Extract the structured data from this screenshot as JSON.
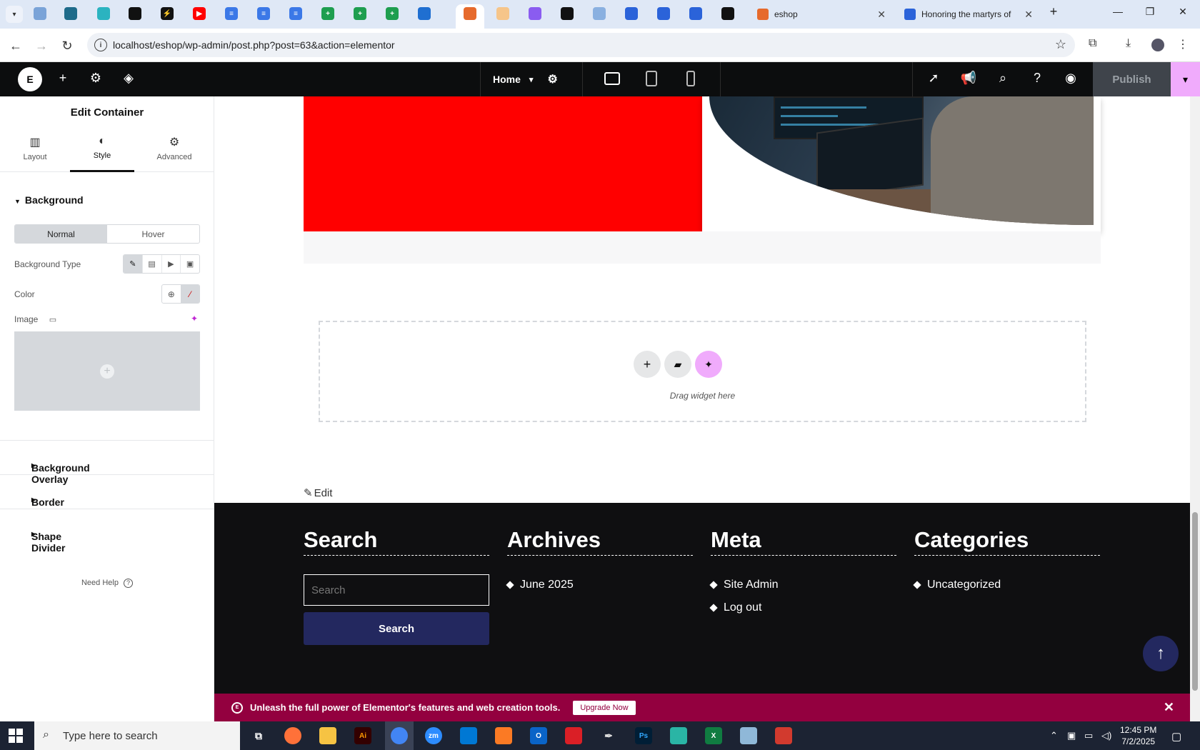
{
  "browser": {
    "tabs": [
      {
        "title": "eshop",
        "favicon_color": "#e66a2c"
      },
      {
        "title": "Honoring the martyrs of",
        "favicon_color": "#2b63d9"
      }
    ],
    "address": "localhost/eshop/wp-admin/post.php?post=63&action=elementor"
  },
  "elementor_bar": {
    "page_name": "Home",
    "publish_label": "Publish"
  },
  "panel": {
    "title": "Edit Container",
    "tabs": [
      {
        "label": "Layout",
        "icon": "layout-icon"
      },
      {
        "label": "Style",
        "icon": "style-icon"
      },
      {
        "label": "Advanced",
        "icon": "gear-icon"
      }
    ],
    "background_section": "Background",
    "state_tabs": [
      "Normal",
      "Hover"
    ],
    "background_type_label": "Background Type",
    "color_label": "Color",
    "image_label": "Image",
    "collapsed_sections": [
      "Background Overlay",
      "Border",
      "Shape Divider"
    ],
    "need_help": "Need Help"
  },
  "canvas": {
    "drop_text": "Drag widget here",
    "edit_link": "Edit"
  },
  "footer": {
    "columns": [
      {
        "heading": "Search",
        "items": []
      },
      {
        "heading": "Archives",
        "items": [
          "June 2025"
        ]
      },
      {
        "heading": "Meta",
        "items": [
          "Site Admin",
          "Log out"
        ]
      },
      {
        "heading": "Categories",
        "items": [
          "Uncategorized"
        ]
      }
    ],
    "search_placeholder": "Search",
    "search_button": "Search"
  },
  "promo": {
    "text": "Unleash the full power of Elementor's features and web creation tools.",
    "button": "Upgrade Now"
  },
  "taskbar": {
    "search_placeholder": "Type here to search",
    "time": "12:45 PM",
    "date": "7/2/2025"
  },
  "colors": {
    "elementor_accent": "#f0abfc",
    "footer_bg": "#0f0f11",
    "footer_button": "#23285f",
    "promo_bg": "#93003f",
    "red_block": "#ff0000"
  }
}
